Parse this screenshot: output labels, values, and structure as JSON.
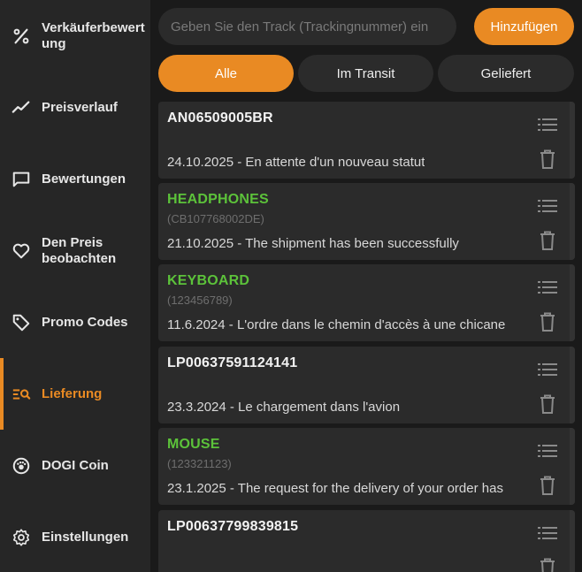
{
  "sidebar": {
    "items": [
      {
        "label": "Verkäuferbewertung",
        "icon": "percent-icon"
      },
      {
        "label": "Preisverlauf",
        "icon": "trend-line-icon"
      },
      {
        "label": "Bewertungen",
        "icon": "chat-bubble-icon"
      },
      {
        "label": "Den Preis beobachten",
        "icon": "heart-icon"
      },
      {
        "label": "Promo Codes",
        "icon": "tag-icon"
      },
      {
        "label": "Lieferung",
        "icon": "delivery-search-icon",
        "active": true
      },
      {
        "label": "DOGI Coin",
        "icon": "coin-icon"
      },
      {
        "label": "Einstellungen",
        "icon": "gear-icon"
      }
    ]
  },
  "search": {
    "placeholder": "Geben Sie den Track (Trackingnummer) ein",
    "value": ""
  },
  "add_label": "Hinzufügen",
  "filters": [
    {
      "label": "Alle",
      "active": true
    },
    {
      "label": "Im Transit",
      "active": false
    },
    {
      "label": "Geliefert",
      "active": false
    }
  ],
  "tracks": [
    {
      "title": "AN06509005BR",
      "named": false,
      "sub": "",
      "status": "24.10.2025 - En attente d'un nouveau statut"
    },
    {
      "title": "HEADPHONES",
      "named": true,
      "sub": "(CB107768002DE)",
      "status": "21.10.2025 - The shipment has been successfully"
    },
    {
      "title": "KEYBOARD",
      "named": true,
      "sub": "(123456789)",
      "status": "11.6.2024 - L'ordre dans le chemin d'accès à une chicane"
    },
    {
      "title": "LP00637591124141",
      "named": false,
      "sub": "",
      "status": "23.3.2024 - Le chargement dans l'avion"
    },
    {
      "title": "MOUSE",
      "named": true,
      "sub": "(123321123)",
      "status": "23.1.2025 - The request for the delivery of your order has"
    },
    {
      "title": "LP00637799839815",
      "named": false,
      "sub": "",
      "status": ""
    }
  ],
  "colors": {
    "accent": "#e98a23",
    "named_title": "#5cc23a",
    "sidebar_bg": "#262626",
    "card_bg": "#2b2b2b"
  }
}
